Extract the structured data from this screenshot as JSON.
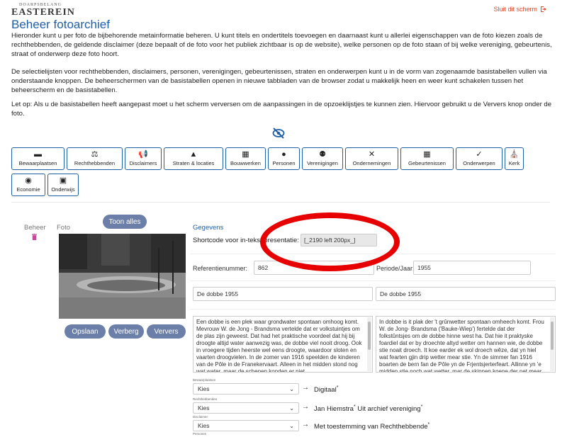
{
  "header": {
    "logo_small": "DOARPSBELANG",
    "logo": "EASTEREIN",
    "signout_label": "Sluit dit scherm"
  },
  "page": {
    "title": "Beheer fotoarchief",
    "intro_1": "Hieronder kunt u per foto de bijbehorende metainformatie beheren. U kunt titels en ondertitels toevoegen en daarnaast kunt u allerlei eigenschappen van de foto kiezen zoals de rechthebbenden, de geldende disclaimer (deze bepaalt of de foto voor het publiek zichtbaar is op de website), welke personen op de foto staan of bij welke vereniging, gebeurtenis, straat of onderwerp deze foto hoort.",
    "intro_2": "De selectielijsten voor rechthebbenden, disclaimers, personen, verenigingen, gebeurtenissen, straten en onderwerpen kunt u in de vorm van zogenaamde basistabellen vullen via onderstaande knoppen. De beheerschermen van de basistabellen openen in nieuwe tabbladen van de browser zodat u makkelijk heen en weer kunt schakelen tussen het beheerscherm en de basistabellen.",
    "intro_3": "Let op: Als u de basistabellen heeft aangepast moet u het scherm verversen om de aanpassingen in de opzoeklijstjes te kunnen zien. Hiervoor gebruikt u de Ververs knop onder de foto."
  },
  "toolbar": [
    {
      "label": "Bewaarplaatsen",
      "icon": "archive-icon",
      "glyph": "▬"
    },
    {
      "label": "Rechthebbenden",
      "icon": "scale-icon",
      "glyph": "⚖"
    },
    {
      "label": "Disclaimers",
      "icon": "megaphone-icon",
      "glyph": "📢"
    },
    {
      "label": "Straten & locaties",
      "icon": "road-icon",
      "glyph": "▲"
    },
    {
      "label": "Bouwwerken",
      "icon": "building-icon",
      "glyph": "▦"
    },
    {
      "label": "Personen",
      "icon": "person-icon",
      "glyph": "●"
    },
    {
      "label": "Verenigingen",
      "icon": "users-icon",
      "glyph": "⚉"
    },
    {
      "label": "Ondernemingen",
      "icon": "tools-icon",
      "glyph": "✕"
    },
    {
      "label": "Gebeurtenissen",
      "icon": "calendar-icon",
      "glyph": "▦"
    },
    {
      "label": "Onderwerpen",
      "icon": "check-icon",
      "glyph": "✓"
    },
    {
      "label": "Kerk",
      "icon": "church-icon",
      "glyph": "⛪"
    }
  ],
  "toolbar2": [
    {
      "label": "Economie",
      "icon": "coins-icon",
      "glyph": "◉"
    },
    {
      "label": "Onderwijs",
      "icon": "school-icon",
      "glyph": "▣"
    }
  ],
  "left": {
    "beheer_label": "Beheer",
    "foto_label": "Foto",
    "toon_alles": "Toon alles",
    "opslaan": "Opslaan",
    "verberg": "Verberg",
    "ververs": "Ververs"
  },
  "form": {
    "gegevens_label": "Gegevens",
    "shortcode_label": "Shortcode voor in-tekst presentatie:",
    "shortcode_value": "[_2190 left 200px_]",
    "referentie_label": "Referentienummer:",
    "referentie_value": "862",
    "periode_label": "Periode/Jaar:",
    "periode_value": "1955",
    "title_nl": "De dobbe 1955",
    "title_fy": "De dobbe 1955",
    "desc_nl": "Een dobbe is een plek waar grondwater spontaan omhoog komt. Mevrouw W. de Jong - Brandsma vertelde dat er volkstuintjes om de plas zijn geweest. Dat had het praktische voordeel dat hij bij droogte altijd water aanwezig was, de dobbe viel nooit droog. Ook in vroegere tijden heerste wel eens droogte, waardoor sloten en vaarten droogvielen. In de zomer van 1916 speelden de kinderen van de Pôle in de Franekervaart. Alleen in het midden stond nog wat water, maar de schepen konden er niet",
    "desc_fy": "In dobbe is it plak der 't grûnwetter spontaan omheech komt. Frou W. de Jong- Brandsma ('Bauke-Wiep') fertelde dat der folkstûntsjes om de dobbe hinne west ha. Dat hie it praktyske foardiel dat er by droechte altyd wetter om hannen wie, de dobbe stie noait droech. It koe earder ek wol droech wêze, dat yn hiel wat fearten gjin drip wetter mear stie. Yn de simmer fan 1916 boarten de bern fan de Pôle yn de Frjentsjerterfeart. Allinne yn 'e midden stie noch wat wetter, mar de skippen koene der net mear",
    "bewaarplaatsen_label": "Bewaarplaatsen",
    "bewaarplaatsen_select": "Kies",
    "bewaarplaatsen_value": "Digitaal",
    "rechthebbenden_label": "Rechthebbenden",
    "rechthebbenden_select": "Kies",
    "rechthebbenden_value": "Jan Hiemstra",
    "rechthebbenden_value2": "Uit archief vereniging",
    "disclaimer_label": "Disclaimer",
    "disclaimer_select": "Kies",
    "disclaimer_value": "Met toestemming van Rechthebbende",
    "personen_label": "Personen",
    "asterisk": "*",
    "arrow": "→"
  }
}
